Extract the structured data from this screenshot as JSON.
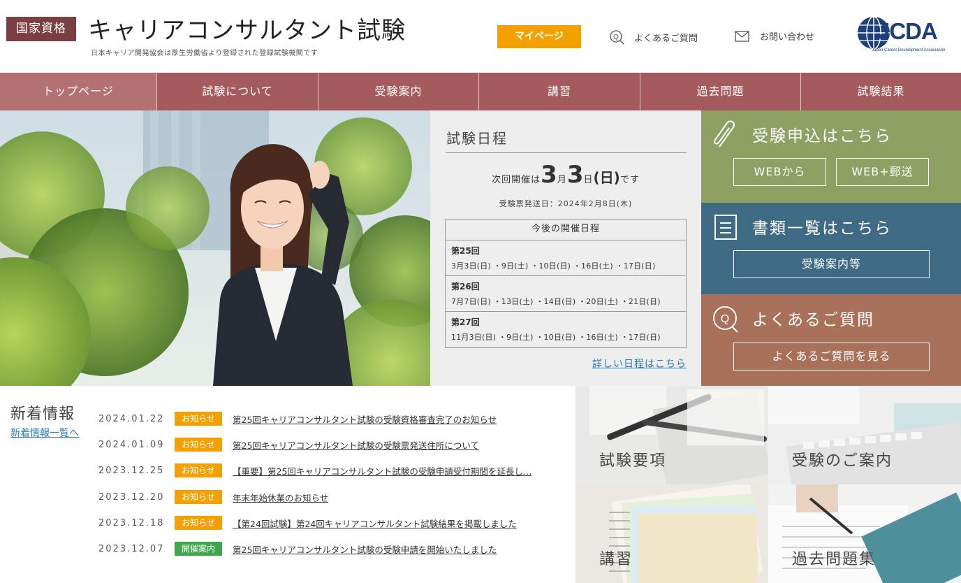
{
  "header": {
    "badge": "国家資格",
    "title": "キャリアコンサルタント試験",
    "subtitle": "日本キャリア開発協会は厚生労働省より登録された登録試験機関です",
    "mypage": "マイページ",
    "faq_link": "よくあるご質問",
    "contact_link": "お問い合わせ",
    "logo_text": "JCDA",
    "logo_sub": "Japan Career Development Association"
  },
  "nav": {
    "items": [
      {
        "label": "トップページ"
      },
      {
        "label": "試験について"
      },
      {
        "label": "受験案内"
      },
      {
        "label": "講習"
      },
      {
        "label": "過去問題"
      },
      {
        "label": "試験結果"
      }
    ]
  },
  "schedule": {
    "title": "試験日程",
    "next_prefix": "次回開催は",
    "next_month": "3",
    "month_unit": "月",
    "next_day": "3",
    "day_unit": "日",
    "next_weekday": "(日)",
    "next_suffix": "です",
    "ticket_date": "受験票発送日：2024年2月8日(木)",
    "upcoming_title": "今後の開催日程",
    "rounds": [
      {
        "name": "第25回",
        "dates": "3月3日(日) ・9日(土) ・10日(日) ・16日(土) ・17日(日)"
      },
      {
        "name": "第26回",
        "dates": "7月7日(日) ・13日(土) ・14日(日) ・20日(土) ・21日(日)"
      },
      {
        "name": "第27回",
        "dates": "11月3日(日) ・9日(土) ・10日(日) ・16日(土) ・17日(日)"
      }
    ],
    "detail_link": "詳しい日程はこちら"
  },
  "panels": {
    "apply": {
      "title": "受験申込はこちら",
      "btn_web": "WEBから",
      "btn_mail": "WEB+郵送"
    },
    "docs": {
      "title": "書類一覧はこちら",
      "btn": "受験案内等"
    },
    "faq": {
      "title": "よくあるご質問",
      "btn": "よくあるご質問を見る"
    }
  },
  "news": {
    "title": "新着情報",
    "all_link": "新着情報一覧へ",
    "items": [
      {
        "date": "2024.01.22",
        "tag": "お知らせ",
        "text": "第25回キャリアコンサルタント試験の受験資格審査完了のお知らせ"
      },
      {
        "date": "2024.01.09",
        "tag": "お知らせ",
        "text": "第25回キャリアコンサルタント試験の受験票発送住所について"
      },
      {
        "date": "2023.12.25",
        "tag": "お知らせ",
        "text": "【重要】第25回キャリアコンサルタント試験の受験申請受付期間を延長し…"
      },
      {
        "date": "2023.12.20",
        "tag": "お知らせ",
        "text": "年末年始休業のお知らせ"
      },
      {
        "date": "2023.12.18",
        "tag": "お知らせ",
        "text": "【第24回試験】第24回キャリアコンサルタント試験結果を掲載しました"
      },
      {
        "date": "2023.12.07",
        "tag": "開催案内",
        "text": "第25回キャリアコンサルタント試験の受験申請を開始いたしました"
      }
    ]
  },
  "tiles": {
    "t1": "試験要項",
    "t2": "受験のご案内",
    "t3": "講習",
    "t4": "過去問題集"
  },
  "colors": {
    "brand": "#a55a5e",
    "accent": "#f3a000",
    "tag_info": "#f3a000",
    "tag_event": "#3fa84a",
    "apply": "#8fa063",
    "docs": "#3f6a83",
    "faq": "#a9705a"
  }
}
